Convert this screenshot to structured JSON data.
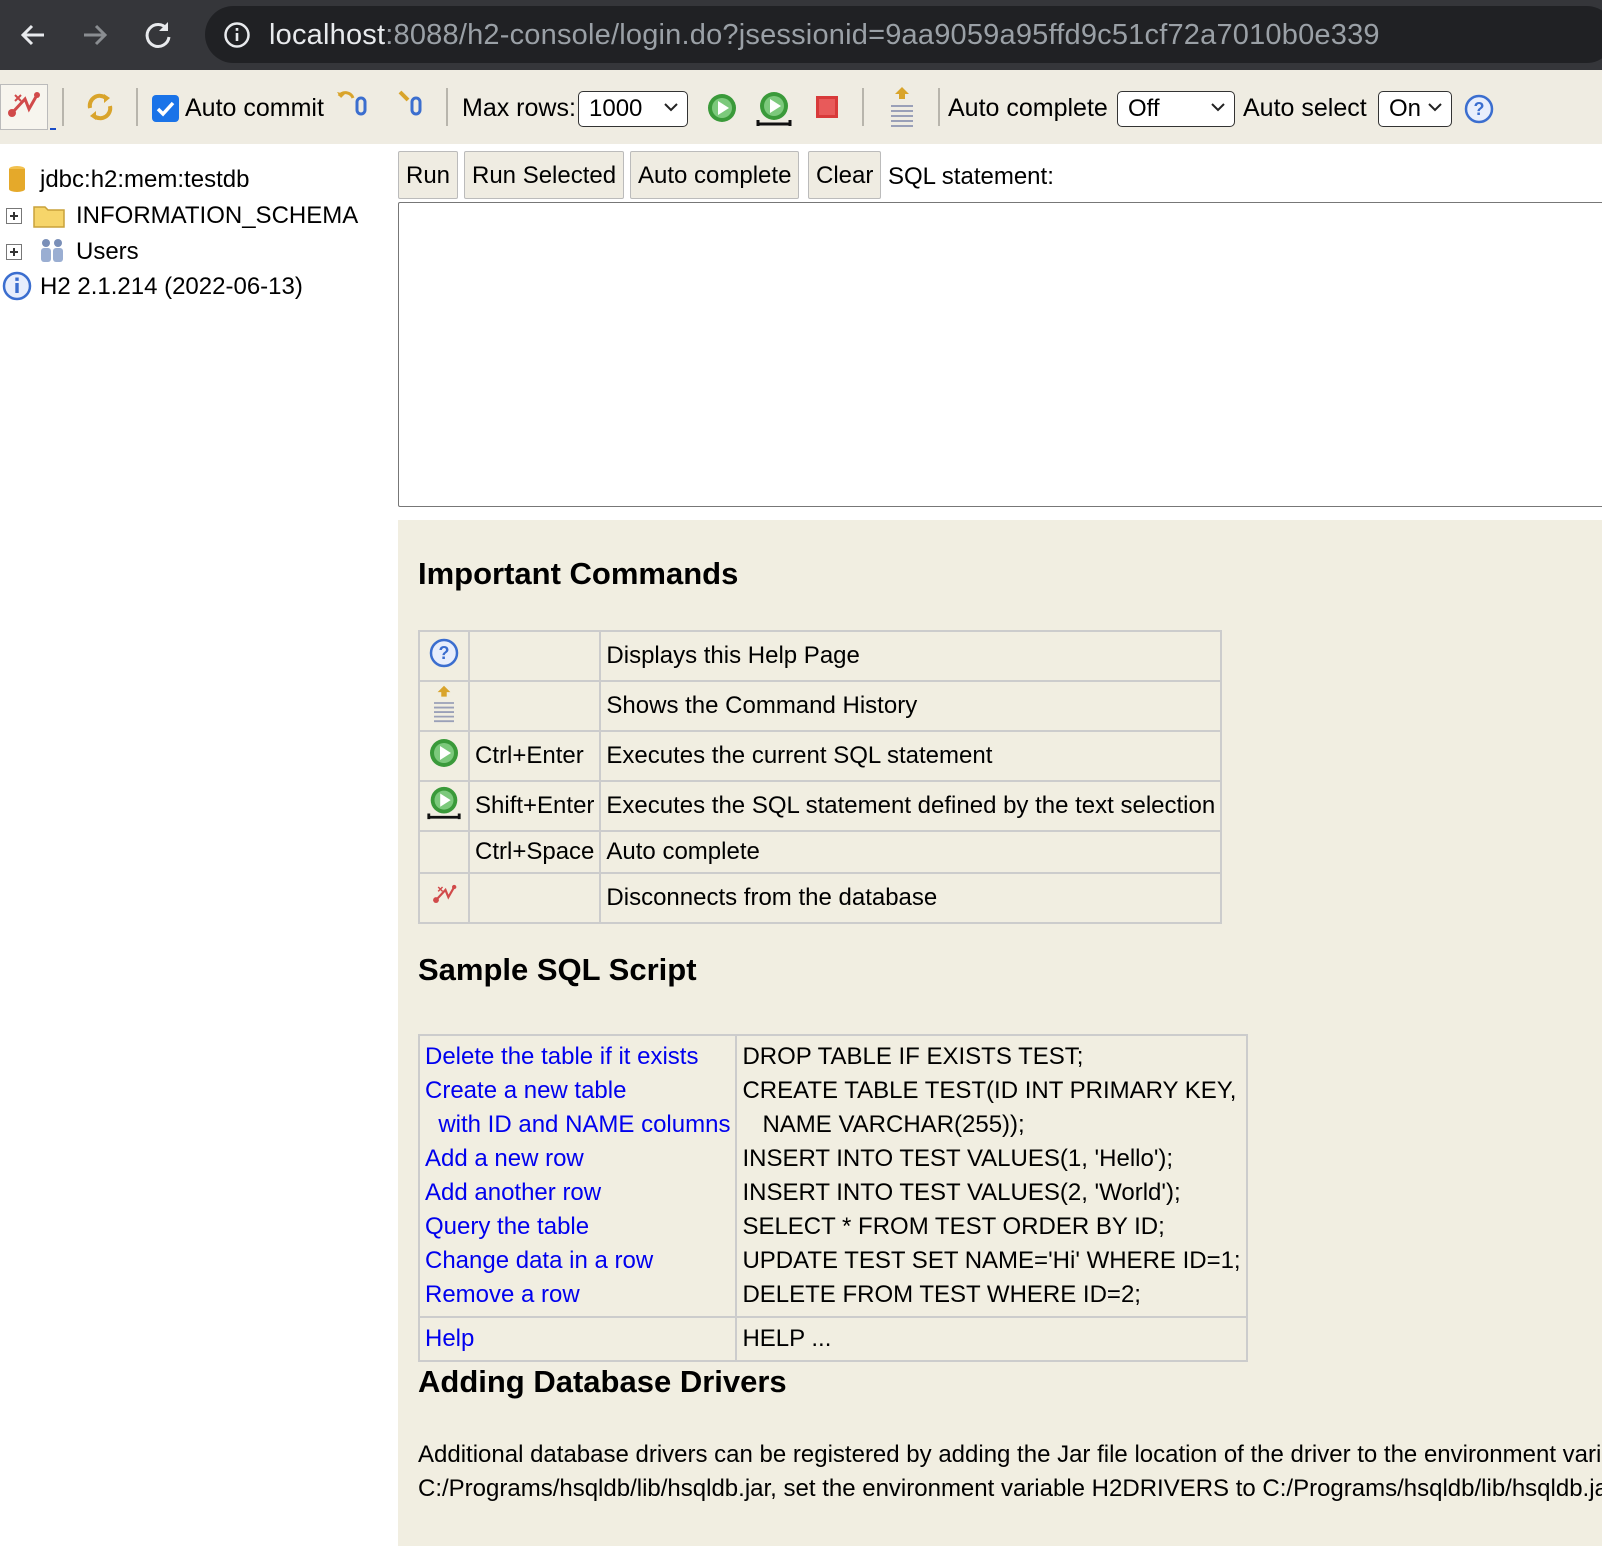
{
  "browser": {
    "url_host": "localhost",
    "url_rest": ":8088/h2-console/login.do?jsessionid=9aa9059a95ffd9c51cf72a7010b0e339"
  },
  "toolbar": {
    "auto_commit_label": "Auto commit",
    "auto_commit_checked": true,
    "max_rows_label": "Max rows:",
    "max_rows_value": "1000",
    "auto_complete_label": "Auto complete",
    "auto_complete_value": "Off",
    "auto_select_label": "Auto select",
    "auto_select_value": "On"
  },
  "tree": {
    "connection": "jdbc:h2:mem:testdb",
    "schema": "INFORMATION_SCHEMA",
    "users": "Users",
    "version": "H2 2.1.214 (2022-06-13)"
  },
  "query": {
    "run": "Run",
    "run_selected": "Run Selected",
    "auto_complete": "Auto complete",
    "clear": "Clear",
    "sql_label": "SQL statement:",
    "sql_value": ""
  },
  "help": {
    "important_title": "Important Commands",
    "commands": [
      {
        "icon": "help-icon",
        "key": "",
        "desc": "Displays this Help Page"
      },
      {
        "icon": "history-icon",
        "key": "",
        "desc": "Shows the Command History"
      },
      {
        "icon": "run-icon",
        "key": "Ctrl+Enter",
        "desc": "Executes the current SQL statement"
      },
      {
        "icon": "run-selected-icon",
        "key": "Shift+Enter",
        "desc": "Executes the SQL statement defined by the text selection"
      },
      {
        "icon": "",
        "key": "Ctrl+Space",
        "desc": "Auto complete"
      },
      {
        "icon": "disconnect-icon",
        "key": "",
        "desc": "Disconnects from the database"
      }
    ],
    "sample_title": "Sample SQL Script",
    "sample_links": [
      "Delete the table if it exists",
      "Create a new table",
      "  with ID and NAME columns",
      "Add a new row",
      "Add another row",
      "Query the table",
      "Change data in a row",
      "Remove a row"
    ],
    "sample_code": [
      "DROP TABLE IF EXISTS TEST;",
      "CREATE TABLE TEST(ID INT PRIMARY KEY,",
      "   NAME VARCHAR(255));",
      "INSERT INTO TEST VALUES(1, 'Hello');",
      "INSERT INTO TEST VALUES(2, 'World');",
      "SELECT * FROM TEST ORDER BY ID;",
      "UPDATE TEST SET NAME='Hi' WHERE ID=1;",
      "DELETE FROM TEST WHERE ID=2;"
    ],
    "help_link": "Help",
    "help_code": "HELP ...",
    "drivers_title": "Adding Database Drivers",
    "drivers_line1": "Additional database drivers can be registered by adding the Jar file location of the driver to the environment vari",
    "drivers_line2": "C:/Programs/hsqldb/lib/hsqldb.jar, set the environment variable H2DRIVERS to C:/Programs/hsqldb/lib/hsqldb.ja"
  }
}
